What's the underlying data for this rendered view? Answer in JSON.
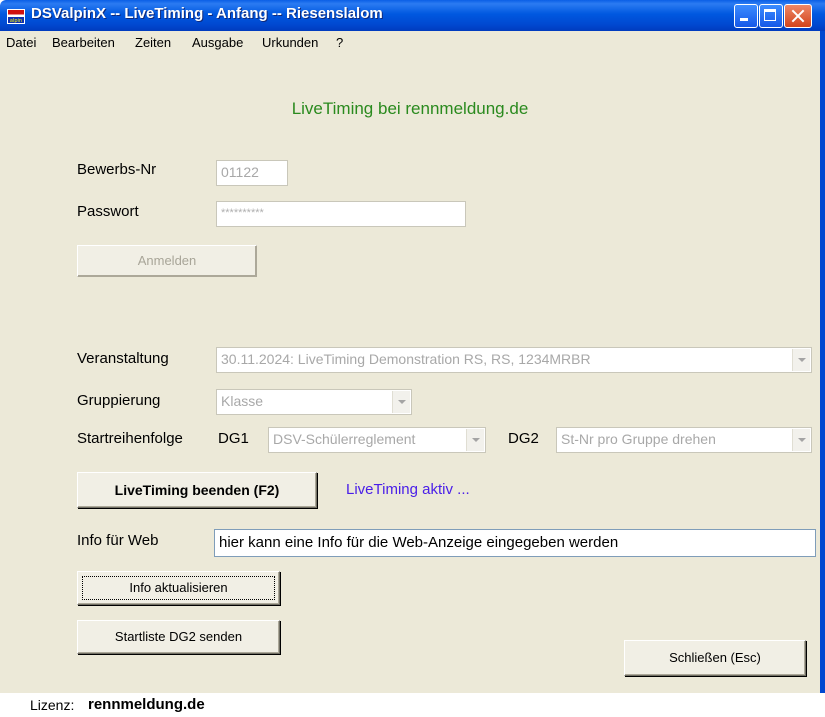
{
  "window": {
    "title": "DSValpinX -- LiveTiming - Anfang -- Riesenslalom",
    "icon_text": "alpin"
  },
  "menu": [
    "Datei",
    "Bearbeiten",
    "Zeiten",
    "Ausgabe",
    "Urkunden",
    "?"
  ],
  "headline": "LiveTiming bei rennmeldung.de",
  "login": {
    "bewerbs_label": "Bewerbs-Nr",
    "bewerbs_value": "01122",
    "passwort_label": "Passwort",
    "passwort_value": "**********",
    "anmelden_label": "Anmelden"
  },
  "event": {
    "veranstaltung_label": "Veranstaltung",
    "veranstaltung_value": "30.11.2024: LiveTiming Demonstration RS, RS, 1234MRBR",
    "gruppierung_label": "Gruppierung",
    "gruppierung_value": "Klasse",
    "startreihenfolge_label": "Startreihenfolge",
    "dg1_label": "DG1",
    "dg1_value": "DSV-Schülerreglement",
    "dg2_label": "DG2",
    "dg2_value": "St-Nr pro Gruppe drehen"
  },
  "livetiming": {
    "button_label": "LiveTiming beenden (F2)",
    "status_text": "LiveTiming aktiv ..."
  },
  "info": {
    "label": "Info für Web",
    "value": "hier kann eine Info für die Web-Anzeige eingegeben werden",
    "update_button": "Info aktualisieren",
    "startliste_button": "Startliste DG2 senden",
    "close_button": "Schließen (Esc)"
  },
  "statusbar": {
    "label": "Lizenz:",
    "value": "rennmeldung.de"
  },
  "colors": {
    "headline": "#2a8a1e",
    "status": "#4a1fe8",
    "titlebar": "#0058e0"
  }
}
